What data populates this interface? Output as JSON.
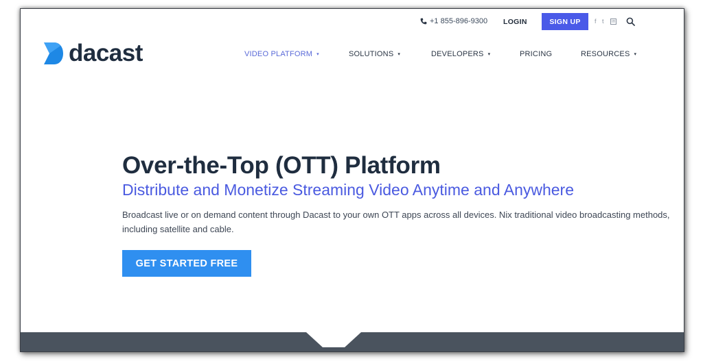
{
  "colors": {
    "brand_blue": "#4a5ae8",
    "cta_blue": "#2f8ff0",
    "logo_blue": "#1e88e5",
    "heading": "#1f2d3f",
    "footer_band": "#4a535e"
  },
  "topbar": {
    "phone_icon": "phone-icon",
    "phone": "+1 855-896-9300",
    "login": "LOGIN",
    "signup": "SIGN UP",
    "social": [
      {
        "icon": "facebook-icon",
        "glyph": "f"
      },
      {
        "icon": "twitter-icon",
        "glyph": "t"
      },
      {
        "icon": "linkedin-icon",
        "glyph": "in"
      }
    ],
    "search_icon": "search-icon"
  },
  "logo": {
    "text": "dacast",
    "icon": "dacast-logo-icon"
  },
  "nav": {
    "items": [
      {
        "label": "VIDEO PLATFORM",
        "dropdown": true,
        "active": true
      },
      {
        "label": "SOLUTIONS",
        "dropdown": true,
        "active": false
      },
      {
        "label": "DEVELOPERS",
        "dropdown": true,
        "active": false
      },
      {
        "label": "PRICING",
        "dropdown": false,
        "active": false
      },
      {
        "label": "RESOURCES",
        "dropdown": true,
        "active": false
      }
    ],
    "caret": "▾"
  },
  "hero": {
    "title": "Over-the-Top (OTT) Platform",
    "subtitle": "Distribute and Monetize Streaming Video Anytime and Anywhere",
    "body": "Broadcast live or on demand content through Dacast to your own OTT apps across all devices. Nix traditional video broadcasting methods, including satellite and cable.",
    "cta": "GET STARTED FREE"
  }
}
